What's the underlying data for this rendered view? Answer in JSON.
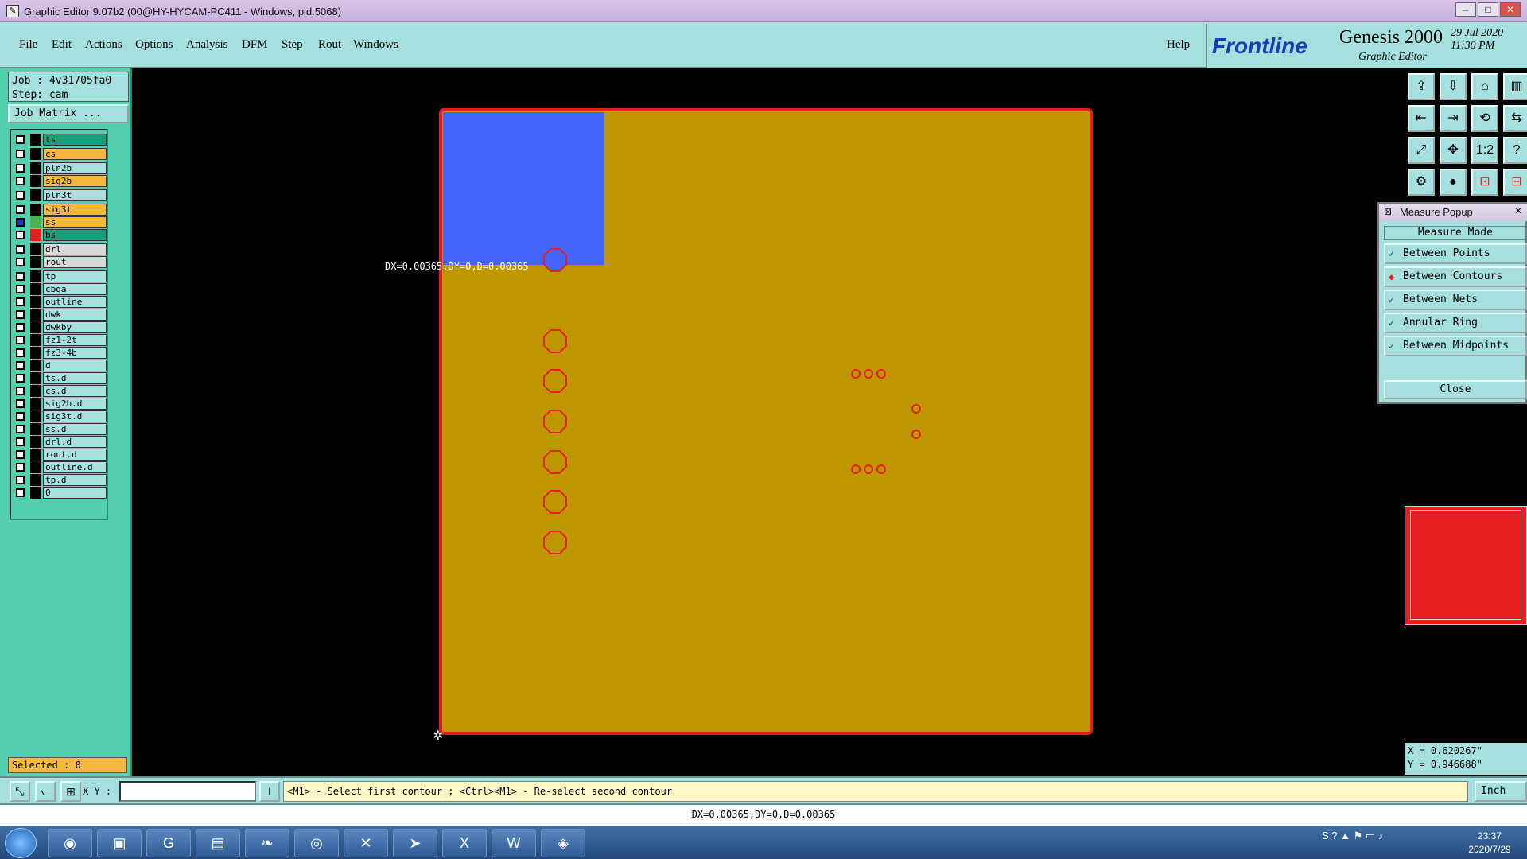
{
  "window": {
    "title": "Graphic Editor 9.07b2 (00@HY-HYCAM-PC411 - Windows, pid:5068)",
    "min": "‒",
    "max": "□",
    "close": "✕"
  },
  "menu": {
    "file": "File",
    "edit": "Edit",
    "actions": "Actions",
    "options": "Options",
    "analysis": "Analysis",
    "dfm": "DFM",
    "step": "Step",
    "rout": "Rout",
    "windows": "Windows",
    "help": "Help"
  },
  "brand": {
    "logo": "Frontline",
    "product": "Genesis 2000",
    "subtitle": "Graphic Editor",
    "date": "29 Jul 2020",
    "time": "11:30 PM"
  },
  "job": {
    "job_line": "Job : 4v31705fa0",
    "step_line": "Step: cam",
    "matrix_button": "Job Matrix ..."
  },
  "layers": [
    {
      "name": "ts",
      "color": "#1a9e7a"
    },
    {
      "name": "cs",
      "color": "#f4b93c"
    },
    {
      "name": "pln2b",
      "color": "#a5e0de"
    },
    {
      "name": "sig2b",
      "color": "#f4b93c"
    },
    {
      "name": "pln3t",
      "color": "#a5e0de"
    },
    {
      "name": "sig3t",
      "color": "#f4b93c"
    },
    {
      "name": "ss",
      "color": "#f4b93c"
    },
    {
      "name": "bs",
      "color": "#1a9e7a"
    },
    {
      "name": "drl",
      "color": "#d8d8d8"
    },
    {
      "name": "rout",
      "color": "#d8d8d8"
    },
    {
      "name": "tp",
      "color": "#a5e0de"
    },
    {
      "name": "cbga",
      "color": "#a5e0de"
    },
    {
      "name": "outline",
      "color": "#a5e0de"
    },
    {
      "name": "dwk",
      "color": "#a5e0de"
    },
    {
      "name": "dwkby",
      "color": "#a5e0de"
    },
    {
      "name": "fz1-2t",
      "color": "#a5e0de"
    },
    {
      "name": "fz3-4b",
      "color": "#a5e0de"
    },
    {
      "name": "d",
      "color": "#a5e0de"
    },
    {
      "name": "ts.d",
      "color": "#a5e0de"
    },
    {
      "name": "cs.d",
      "color": "#a5e0de"
    },
    {
      "name": "sig2b.d",
      "color": "#a5e0de"
    },
    {
      "name": "sig3t.d",
      "color": "#a5e0de"
    },
    {
      "name": "ss.d",
      "color": "#a5e0de"
    },
    {
      "name": "drl.d",
      "color": "#a5e0de"
    },
    {
      "name": "rout.d",
      "color": "#a5e0de"
    },
    {
      "name": "outline.d",
      "color": "#a5e0de"
    },
    {
      "name": "tp.d",
      "color": "#a5e0de"
    },
    {
      "name": "0",
      "color": "#a5e0de"
    }
  ],
  "selected": "Selected : 0",
  "canvas": {
    "measure_label": "DX=0.00365,DY=0,D=0.00365"
  },
  "measure_popup": {
    "title": "Measure Popup",
    "header": "Measure Mode",
    "items": [
      "Between Points",
      "Between Contours",
      "Between Nets",
      "Annular Ring",
      "Between Midpoints"
    ],
    "active_index": 1,
    "close": "Close"
  },
  "coords": {
    "x": "X = 0.620267\"",
    "y": "Y = 0.946688\""
  },
  "bottom": {
    "xy_label": "X Y :",
    "xy_value": "",
    "prompt": "<M1> - Select first contour ; <Ctrl><M1> - Re-select second contour",
    "unit": "Inch"
  },
  "status": "DX=0.00365,DY=0,D=0.00365",
  "taskbar": {
    "time": "23:37",
    "date": "2020/7/29"
  },
  "colors": {
    "board": "#bf9600",
    "outline": "#e61e1e",
    "highlight": "#4464fc",
    "panel": "#54cfb0",
    "menu": "#a5e0de"
  }
}
